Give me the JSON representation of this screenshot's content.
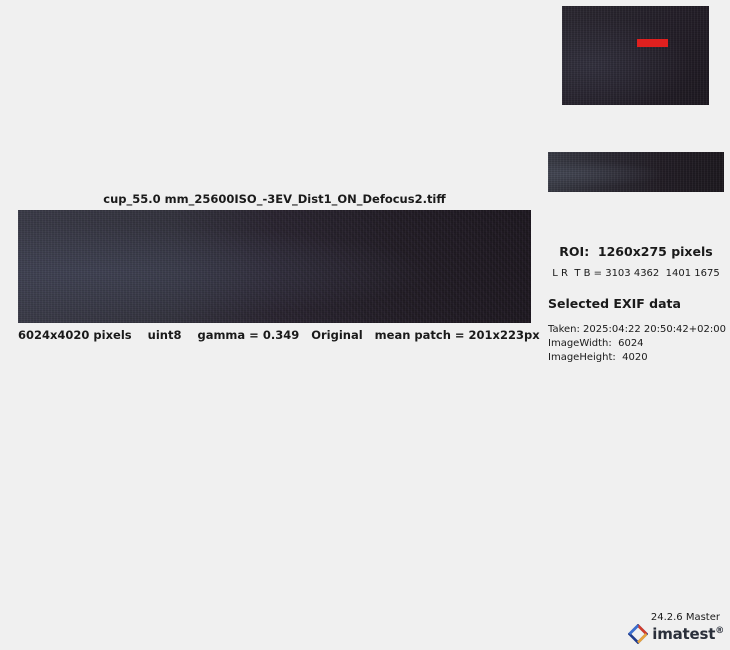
{
  "main": {
    "title": "cup_55.0 mm_25600ISO_-3EV_Dist1_ON_Defocus2.tiff",
    "caption": "6024x4020 pixels    uint8    gamma = 0.349   Original   mean patch = 201x223px"
  },
  "roi": {
    "title": "ROI:  1260x275 pixels",
    "coords": "L R  T B = 3103 4362  1401 1675"
  },
  "exif": {
    "heading": "Selected EXIF data",
    "rows": [
      "Taken: 2025:04:22 20:50:42+02:00",
      "ImageWidth:  6024",
      "ImageHeight:  4020"
    ]
  },
  "footer": {
    "version": "24.2.6 Master",
    "brand": "imatest",
    "registered": "®"
  },
  "colors": {
    "roi_marker": "#e0201f",
    "background": "#f0f0f0"
  }
}
